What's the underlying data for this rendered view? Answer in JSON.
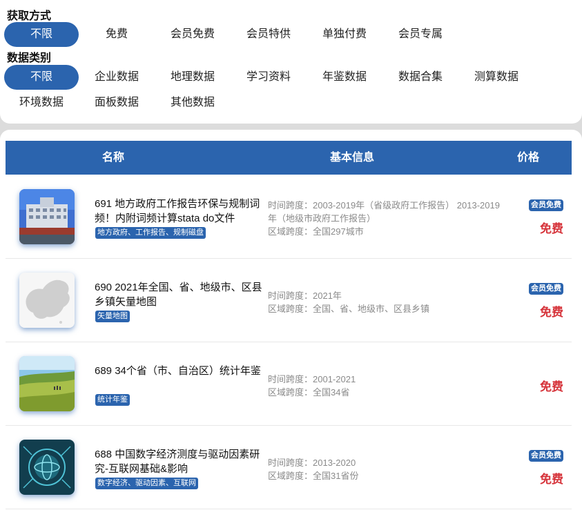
{
  "filters": {
    "acquire": {
      "title": "获取方式",
      "options": [
        "不限",
        "免费",
        "会员免费",
        "会员特供",
        "单独付费",
        "会员专属"
      ],
      "selected": "不限"
    },
    "category": {
      "title": "数据类别",
      "options": [
        "不限",
        "企业数据",
        "地理数据",
        "学习资料",
        "年鉴数据",
        "数据合集",
        "测算数据",
        "环境数据",
        "面板数据",
        "其他数据"
      ],
      "selected": "不限"
    }
  },
  "table": {
    "headers": {
      "name": "名称",
      "info": "基本信息",
      "price": "价格"
    }
  },
  "items": [
    {
      "title": "691 地方政府工作报告环保与规制词频！内附词频计算stata do文件",
      "tags": "地方政府、工作报告、规制磁盘",
      "info": [
        "时间跨度：2003-2019年（省级政府工作报告） 2013-2019年（地级市政府工作报告）",
        "区域跨度：全国297城市"
      ],
      "badge": "会员免费",
      "price": "免费",
      "thumb_icon": "government-building-icon"
    },
    {
      "title": "690 2021年全国、省、地级市、区县乡镇矢量地图",
      "tags": "矢量地图",
      "info": [
        "时间跨度：2021年",
        "区域跨度：全国、省、地级市、区县乡镇"
      ],
      "badge": "会员免费",
      "price": "免费",
      "thumb_icon": "china-map-icon"
    },
    {
      "title": "689 34个省（市、自治区）统计年鉴",
      "tags": "统计年鉴",
      "info": [
        "时间跨度：2001-2021",
        "区域跨度：全国34省"
      ],
      "badge": "",
      "price": "免费",
      "thumb_icon": "grassland-icon"
    },
    {
      "title": "688 中国数字经济测度与驱动因素研究-互联网基础&影响",
      "tags": "数字经济、驱动因素、互联网",
      "info": [
        "时间跨度：2013-2020",
        "区域跨度：全国31省份"
      ],
      "badge": "会员免费",
      "price": "免费",
      "thumb_icon": "digital-globe-icon"
    }
  ],
  "colors": {
    "accent": "#2b64ae",
    "price": "#d6343b",
    "muted": "#8a8a8a"
  }
}
